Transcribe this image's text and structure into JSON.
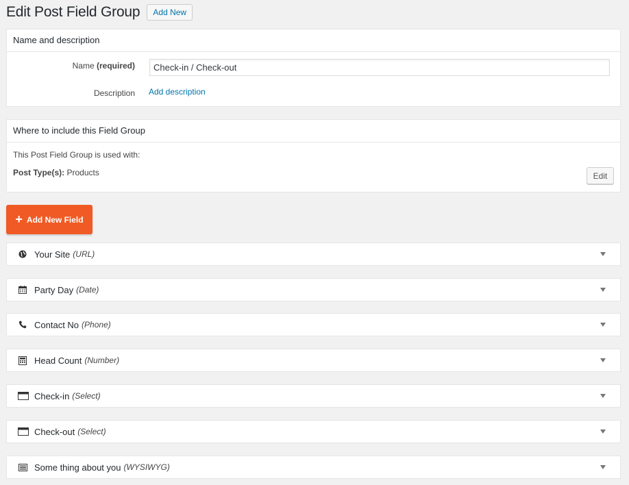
{
  "header": {
    "title": "Edit Post Field Group",
    "add_new_label": "Add New"
  },
  "name_box": {
    "heading": "Name and description",
    "name_label": "Name",
    "name_required": "(required)",
    "name_value": "Check-in / Check-out",
    "description_label": "Description",
    "add_description_link": "Add description"
  },
  "where_box": {
    "heading": "Where to include this Field Group",
    "used_with_text": "This Post Field Group is used with:",
    "post_types_label": "Post Type(s):",
    "post_types_value": "Products",
    "edit_label": "Edit"
  },
  "add_field_button": "Add New Field",
  "fields": [
    {
      "name": "Your Site",
      "type": "(URL)",
      "icon": "globe-icon"
    },
    {
      "name": "Party Day",
      "type": "(Date)",
      "icon": "calendar-icon"
    },
    {
      "name": "Contact No",
      "type": "(Phone)",
      "icon": "phone-icon"
    },
    {
      "name": "Head Count",
      "type": "(Number)",
      "icon": "calculator-icon"
    },
    {
      "name": "Check-in",
      "type": "(Select)",
      "icon": "select-icon"
    },
    {
      "name": "Check-out",
      "type": "(Select)",
      "icon": "select-icon"
    },
    {
      "name": "Some thing about you",
      "type": "(WYSIWYG)",
      "icon": "wysiwyg-icon"
    }
  ],
  "colors": {
    "accent_orange": "#f05a24",
    "link_blue": "#0073aa",
    "background": "#f1f1f1"
  }
}
